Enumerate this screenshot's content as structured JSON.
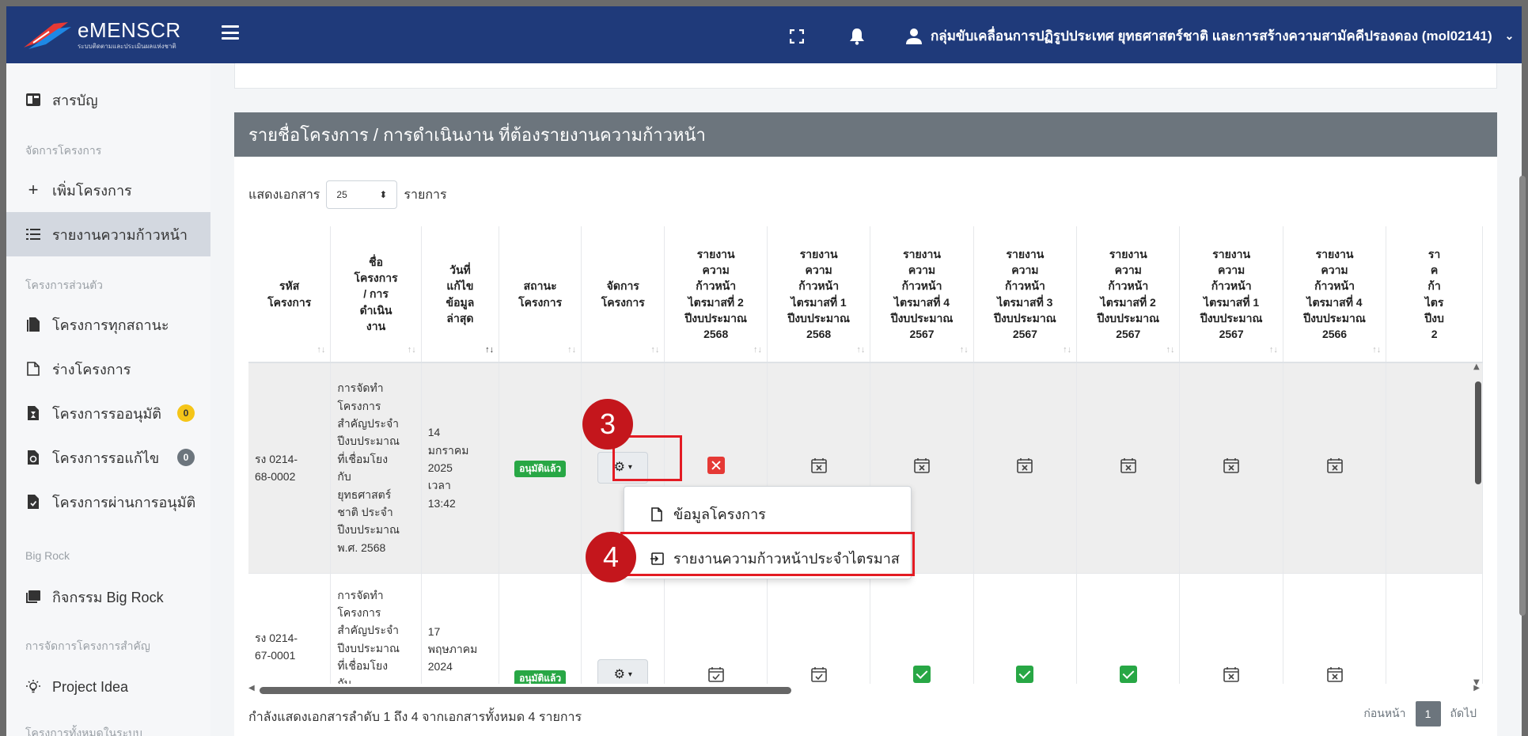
{
  "header": {
    "brand_name": "eMENSCR",
    "brand_sub": "ระบบติดตามและประเมินผลแห่งชาติ",
    "user_name": "กลุ่มขับเคลื่อนการปฏิรูปประเทศ ยุทธศาสตร์ชาติ และการสร้างความสามัคคีปรองดอง (mol02141)",
    "icons": [
      "menu-icon",
      "fullscreen-icon",
      "bell-icon",
      "user-icon",
      "chevron-down-icon"
    ]
  },
  "sidebar": {
    "dashboard": "สารบัญ",
    "section_manage": "จัดการโครงการ",
    "add_project": "เพิ่มโครงการ",
    "progress_report": "รายงานความก้าวหน้า",
    "section_personal": "โครงการส่วนตัว",
    "all_status": "โครงการทุกสถานะ",
    "draft": "ร่างโครงการ",
    "pending_approval": "โครงการรออนุมัติ",
    "pending_approval_count": "0",
    "pending_edit": "โครงการรอแก้ไข",
    "pending_edit_count": "0",
    "approved": "โครงการผ่านการอนุมัติ",
    "section_bigrock": "Big Rock",
    "bigrock_activity": "กิจกรรม Big Rock",
    "section_important": "การจัดการโครงการสำคัญ",
    "project_idea": "Project Idea",
    "section_all": "โครงการทั้งหมดในระบบ"
  },
  "card": {
    "title": "รายชื่อโครงการ / การดำเนินงาน ที่ต้องรายงานความก้าวหน้า",
    "show_label": "แสดงเอกสาร",
    "show_value": "25",
    "show_suffix": "รายการ"
  },
  "table": {
    "headers": [
      "รหัส\nโครงการ",
      "ชื่อ\nโครงการ\n/ การ\nดำเนิน\nงาน",
      "วันที่\nแก้ไข\nข้อมูล\nล่าสุด",
      "สถานะ\nโครงการ",
      "จัดการ\nโครงการ",
      "รายงาน\nความ\nก้าวหน้า\nไตรมาสที่ 2\nปีงบประมาณ\n2568",
      "รายงาน\nความ\nก้าวหน้า\nไตรมาสที่ 1\nปีงบประมาณ\n2568",
      "รายงาน\nความ\nก้าวหน้า\nไตรมาสที่ 4\nปีงบประมาณ\n2567",
      "รายงาน\nความ\nก้าวหน้า\nไตรมาสที่ 3\nปีงบประมาณ\n2567",
      "รายงาน\nความ\nก้าวหน้า\nไตรมาสที่ 2\nปีงบประมาณ\n2567",
      "รายงาน\nความ\nก้าวหน้า\nไตรมาสที่ 1\nปีงบประมาณ\n2567",
      "รายงาน\nความ\nก้าวหน้า\nไตรมาสที่ 4\nปีงบประมาณ\n2566",
      "รา\nค\nก้า\nไตร\nปีงบ\n2"
    ],
    "rows": [
      {
        "code": "รง 0214-\n68-0002",
        "name": "การจัดทำ\nโครงการ\nสำคัญประจำ\nปีงบประมาณ\nที่เชื่อมโยง\nกับ\nยุทธศาสตร์\nชาติ ประจำ\nปีงบประมาณ\nพ.ศ. 2568",
        "date": "14\nมกราคม\n2025\nเวลา\n13:42",
        "status": "อนุมัติแล้ว",
        "reports": [
          "x-red",
          "calendar-x",
          "calendar-x",
          "calendar-x",
          "calendar-x",
          "calendar-x",
          "calendar-x"
        ]
      },
      {
        "code": "รง 0214-\n67-0001",
        "name": "การจัดทำ\nโครงการ\nสำคัญประจำ\nปีงบประมาณ\nที่เชื่อมโยง\nกับ",
        "date": "17\nพฤษภาคม\n2024",
        "status": "อนุมัติแล้ว",
        "reports": [
          "calendar-check",
          "calendar-check",
          "check-green",
          "check-green",
          "check-green",
          "calendar-x",
          "calendar-x"
        ]
      }
    ]
  },
  "dropdown": {
    "item1": "ข้อมูลโครงการ",
    "item2": "รายงานความก้าวหน้าประจำไตรมาส"
  },
  "footer": {
    "info": "กำลังแสดงเอกสารลำดับ 1 ถึง 4 จากเอกสารทั้งหมด 4 รายการ",
    "prev": "ก่อนหน้า",
    "page": "1",
    "next": "ถัดไป"
  },
  "annotations": {
    "step3": "3",
    "step4": "4"
  },
  "colors": {
    "topbar": "#1f3a7a",
    "card_header": "#6c757d",
    "highlight": "#e31b23",
    "step_circle": "#c4161c",
    "success": "#28a745",
    "danger": "#e53935"
  }
}
